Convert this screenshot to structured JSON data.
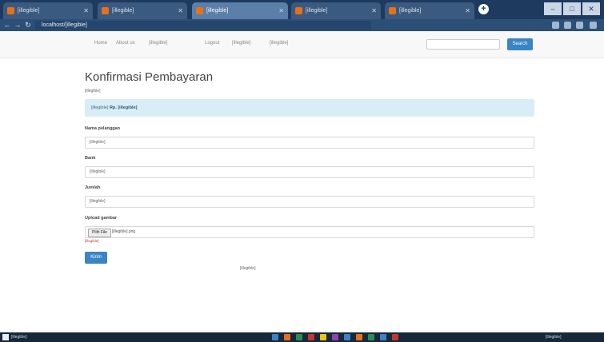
{
  "browser": {
    "tabs": [
      {
        "title": "[illegible]",
        "active": false
      },
      {
        "title": "[illegible]",
        "active": false
      },
      {
        "title": "[illegible]",
        "active": true
      },
      {
        "title": "[illegible]",
        "active": false
      },
      {
        "title": "[illegible]",
        "active": false
      }
    ],
    "url": "localhost/[illegible]",
    "window_controls": {
      "minimize": "–",
      "maximize": "□",
      "close": "✕"
    }
  },
  "nav": {
    "items": [
      "Home",
      "About us",
      "[illegible]",
      "Logout",
      "[illegible]",
      "[illegible]"
    ],
    "search_placeholder": "",
    "search_button": "Search"
  },
  "page": {
    "title": "Konfirmasi Pembayaran",
    "subtitle": "[illegible]",
    "alert_text": "[illegible]",
    "alert_amount": "Rp. [illegible]",
    "fields": [
      {
        "label": "Nama pelanggan",
        "value": "[illegible]"
      },
      {
        "label": "Bank",
        "value": "[illegible]"
      },
      {
        "label": "Jumlah",
        "value": "[illegible]"
      }
    ],
    "upload": {
      "label": "Upload gambar",
      "button": "Pilih File",
      "filename": "[illegible].png",
      "hint": "[illegible]"
    },
    "submit": "Kirim",
    "footer": "[illegible]"
  },
  "taskbar": {
    "start_label": "[illegible]",
    "tray": "[illegible]",
    "app_colors": [
      "#3a84c4",
      "#e8701a",
      "#2e8b57",
      "#c0392b",
      "#f1c40f",
      "#8e44ad",
      "#3a84c4",
      "#e8701a",
      "#2e8b57",
      "#3a84c4",
      "#c0392b"
    ]
  }
}
